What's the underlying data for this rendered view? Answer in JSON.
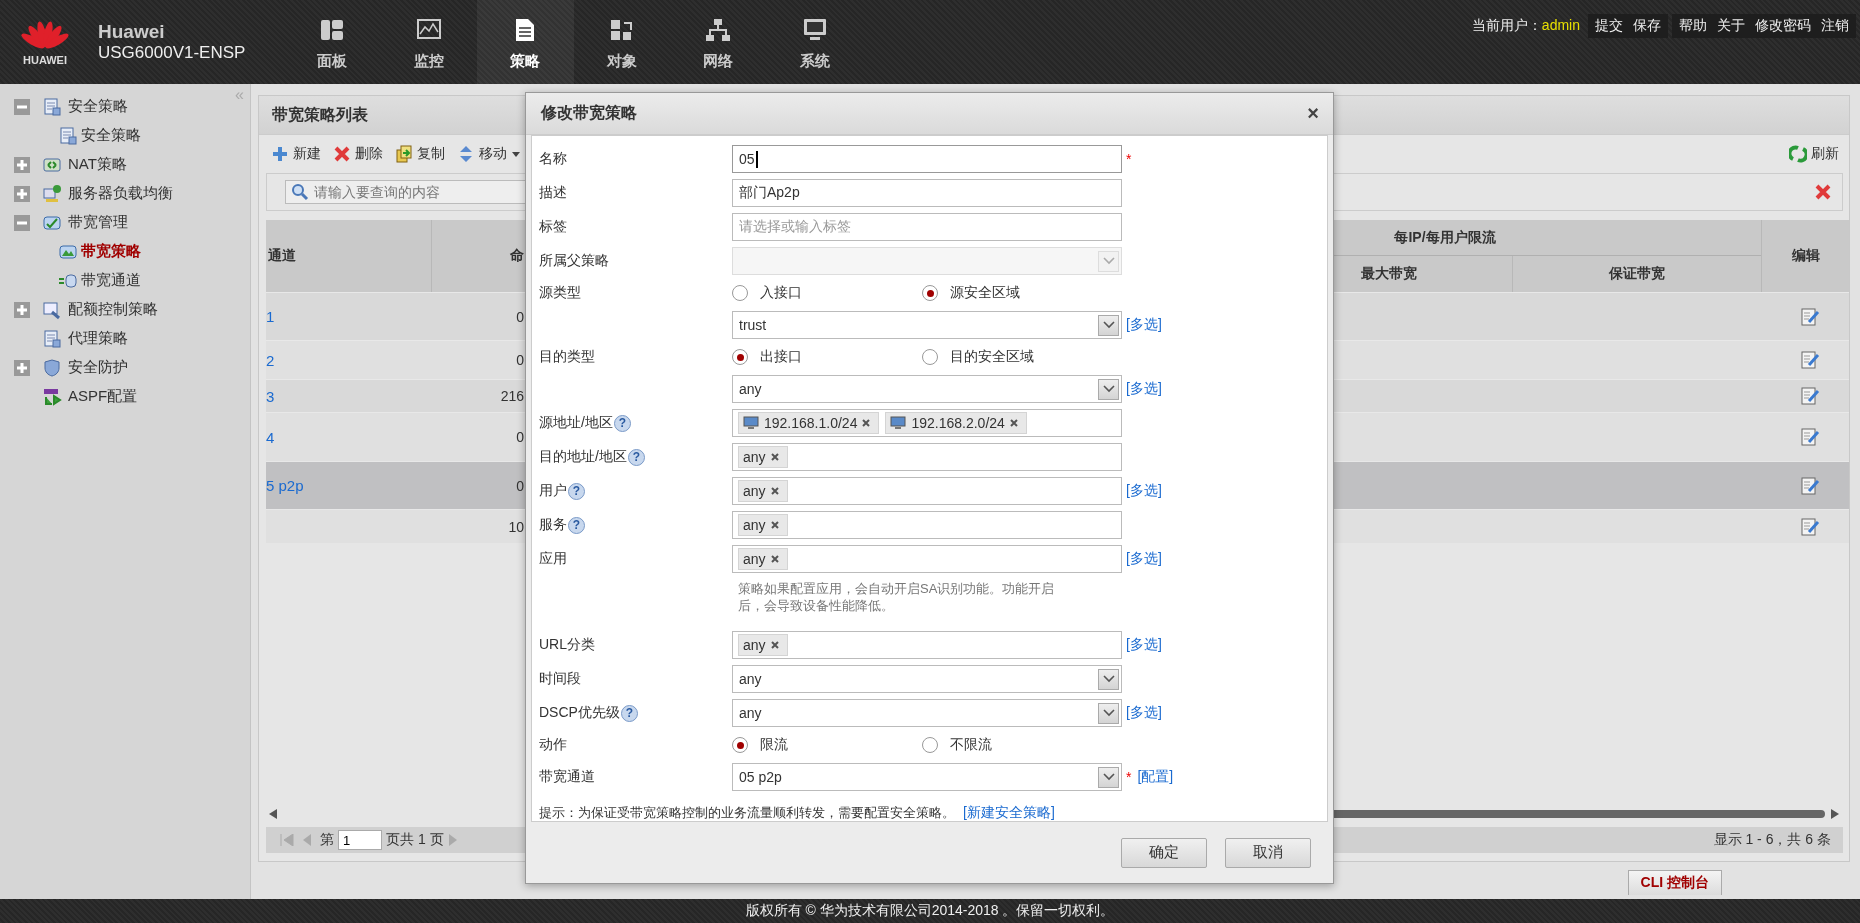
{
  "header": {
    "logo_text": "HUAWEI",
    "brand": "Huawei",
    "model": "USG6000V1-ENSP",
    "nav": [
      {
        "label": "面板",
        "selected": false
      },
      {
        "label": "监控",
        "selected": false
      },
      {
        "label": "策略",
        "selected": true
      },
      {
        "label": "对象",
        "selected": false
      },
      {
        "label": "网络",
        "selected": false
      },
      {
        "label": "系统",
        "selected": false
      }
    ],
    "user_label": "当前用户：",
    "user": "admin",
    "action_groups": [
      [
        "提交",
        "保存"
      ],
      [
        "帮助",
        "关于",
        "修改密码",
        "注销"
      ]
    ]
  },
  "sidebar": {
    "collapse": "«",
    "items": [
      {
        "label": "安全策略",
        "expanded": true,
        "selected": false,
        "children": [
          {
            "label": "安全策略",
            "selected": false
          }
        ]
      },
      {
        "label": "NAT策略",
        "expanded": false,
        "selected": false
      },
      {
        "label": "服务器负载均衡",
        "expanded": false,
        "selected": false
      },
      {
        "label": "带宽管理",
        "expanded": true,
        "selected": false,
        "children": [
          {
            "label": "带宽策略",
            "selected": true
          },
          {
            "label": "带宽通道",
            "selected": false
          }
        ]
      },
      {
        "label": "配额控制策略",
        "expanded": false,
        "selected": false
      },
      {
        "label": "代理策略",
        "selected": false
      },
      {
        "label": "安全防护",
        "expanded": false,
        "selected": false
      },
      {
        "label": "ASPF配置",
        "selected": false
      }
    ]
  },
  "panel": {
    "title": "带宽策略列表",
    "toolbar": [
      {
        "label": "新建",
        "menu": false
      },
      {
        "label": "删除",
        "menu": false
      },
      {
        "label": "复制",
        "menu": false
      },
      {
        "label": "移动",
        "menu": true
      }
    ],
    "refresh": "刷新",
    "search": {
      "placeholder": "请输入要查询的内容"
    },
    "table": {
      "columns": [
        "通道",
        "命"
      ],
      "group": {
        "label": "每IP/每用户限流",
        "columns": [
          "最大带宽",
          "保证带宽"
        ]
      },
      "edit": "编辑",
      "rows": [
        {
          "channel": "1",
          "hits": "0",
          "selected": false
        },
        {
          "channel": "2",
          "hits": "0",
          "selected": false
        },
        {
          "channel": "3",
          "hits": "216",
          "selected": false
        },
        {
          "channel": "4",
          "hits": "0",
          "selected": false
        },
        {
          "channel": "5 p2p",
          "hits": "0",
          "selected": true
        },
        {
          "hits": "10",
          "selected": false
        }
      ]
    },
    "pagination": {
      "page_prefix": "第",
      "page": "1",
      "page_suffix": "页共 1 页",
      "summary": "显示 1 - 6，共 6 条"
    }
  },
  "dialog": {
    "title": "修改带宽策略",
    "close": "×",
    "rows": [
      {
        "kind": "input",
        "label": "名称",
        "value": "05",
        "focused": true,
        "required": "*"
      },
      {
        "kind": "input",
        "label": "描述",
        "value": "部门Ap2p"
      },
      {
        "kind": "input",
        "label": "标签",
        "placeholder": "请选择或输入标签"
      },
      {
        "kind": "select",
        "label": "所属父策略",
        "disabled": true
      },
      {
        "kind": "radio",
        "label": "源类型",
        "options": [
          {
            "label": "入接口",
            "selected": false
          },
          {
            "label": "源安全区域",
            "selected": true
          }
        ]
      },
      {
        "kind": "select",
        "value": "trust",
        "disabled": false,
        "link": "[多选]"
      },
      {
        "kind": "radio",
        "label": "目的类型",
        "options": [
          {
            "label": "出接口",
            "selected": true
          },
          {
            "label": "目的安全区域",
            "selected": false
          }
        ]
      },
      {
        "kind": "select",
        "value": "any",
        "disabled": false,
        "link": "[多选]"
      },
      {
        "kind": "tags",
        "label": "源地址/地区",
        "help": "?",
        "tags": [
          {
            "label": "192.168.1.0/24",
            "kind": "address"
          },
          {
            "label": "192.168.2.0/24",
            "kind": "address"
          }
        ]
      },
      {
        "kind": "tags",
        "label": "目的地址/地区",
        "help": "?",
        "tags": [
          {
            "label": "any",
            "kind": "plain"
          }
        ]
      },
      {
        "kind": "tags",
        "label": "用户",
        "help": "?",
        "tags": [
          {
            "label": "any",
            "kind": "plain"
          }
        ],
        "link": "[多选]"
      },
      {
        "kind": "tags",
        "label": "服务",
        "help": "?",
        "tags": [
          {
            "label": "any",
            "kind": "plain"
          }
        ]
      },
      {
        "kind": "tags",
        "label": "应用",
        "tags": [
          {
            "label": "any",
            "kind": "plain"
          }
        ],
        "link": "[多选]"
      },
      {
        "kind": "note",
        "text": "策略如果配置应用，会自动开启SA识别功能。功能开启后，会导致设备性能降低。"
      },
      {
        "kind": "tags",
        "label": "URL分类",
        "tags": [
          {
            "label": "any",
            "kind": "plain"
          }
        ],
        "link": "[多选]"
      },
      {
        "kind": "select",
        "label": "时间段",
        "value": "any",
        "disabled": false
      },
      {
        "kind": "select",
        "label": "DSCP优先级",
        "help": "?",
        "value": "any",
        "disabled": false,
        "link": "[多选]"
      },
      {
        "kind": "radio",
        "label": "动作",
        "options": [
          {
            "label": "限流",
            "selected": true
          },
          {
            "label": "不限流",
            "selected": false
          }
        ]
      },
      {
        "kind": "select",
        "label": "带宽通道",
        "value": "05 p2p",
        "disabled": false,
        "required": "*",
        "link": "[配置]"
      }
    ],
    "hint": {
      "text": "提示：为保证受带宽策略控制的业务流量顺利转发，需要配置安全策略。",
      "link": "[新建安全策略]"
    },
    "buttons": [
      "确定",
      "取消"
    ]
  },
  "cli_tab": "CLI 控制台",
  "footer": "版权所有 © 华为技术有限公司2014-2018 。保留一切权利。"
}
